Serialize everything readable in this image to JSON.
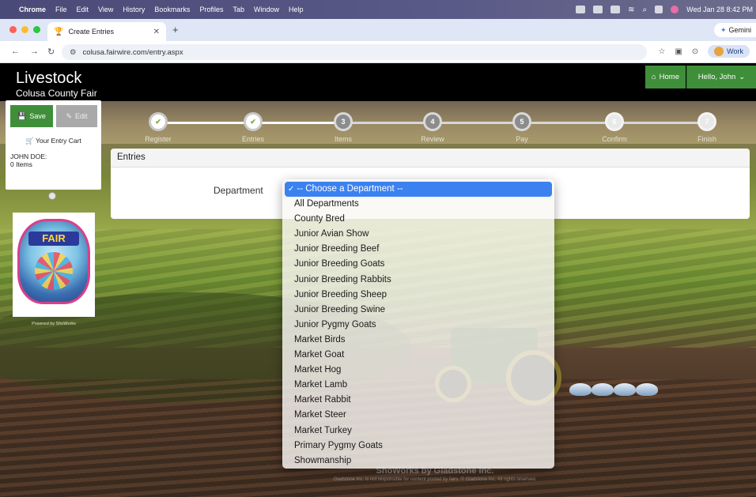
{
  "os_menu": {
    "app": "Chrome",
    "items": [
      "File",
      "Edit",
      "View",
      "History",
      "Bookmarks",
      "Profiles",
      "Tab",
      "Window",
      "Help"
    ],
    "clock": "Wed Jan 28  8:42 PM"
  },
  "browser": {
    "tab_title": "Create Entries",
    "new_tab": "+",
    "gemini_label": "Gemini",
    "url": "colusa.fairwire.com/entry.aspx",
    "profile_label": "Work"
  },
  "site": {
    "title": "Livestock",
    "subtitle": "Colusa County Fair",
    "home_label": "Home",
    "hello_label": "Hello, John"
  },
  "cart": {
    "save_label": "Save",
    "edit_label": "Edit",
    "title": "Your Entry Cart",
    "name": "JOHN DOE:",
    "items": "0 Items"
  },
  "powered_by": "Powered by ShoWorks",
  "steps": [
    {
      "label": "Register",
      "num": "✔",
      "state": "done"
    },
    {
      "label": "Entries",
      "num": "✔",
      "state": "done"
    },
    {
      "label": "Items",
      "num": "3",
      "state": "todo"
    },
    {
      "label": "Review",
      "num": "4",
      "state": "todo"
    },
    {
      "label": "Pay",
      "num": "5",
      "state": "todo"
    },
    {
      "label": "Confirm",
      "num": "6",
      "state": "light"
    },
    {
      "label": "Finish",
      "num": "7",
      "state": "light"
    }
  ],
  "entries": {
    "heading": "Entries",
    "department_label": "Department"
  },
  "dropdown": {
    "selected": "-- Choose a Department --",
    "options": [
      "All Departments",
      "County Bred",
      "Junior Avian Show",
      "Junior Breeding Beef",
      "Junior Breeding Goats",
      "Junior Breeding Rabbits",
      "Junior Breeding Sheep",
      "Junior Breeding Swine",
      "Junior Pygmy Goats",
      "Market Birds",
      "Market Goat",
      "Market Hog",
      "Market Lamb",
      "Market Rabbit",
      "Market Steer",
      "Market Turkey",
      "Primary Pygmy Goats",
      "Showmanship"
    ]
  },
  "footer": {
    "line1": "ShoWorks by Gladstone Inc.",
    "line3": "Gladstone Inc. is not responsible for content posted by fairs. © Gladstone Inc. All rights reserved."
  },
  "colors": {
    "accent_green": "#3f8f3a",
    "select_blue": "#3b82f0"
  }
}
